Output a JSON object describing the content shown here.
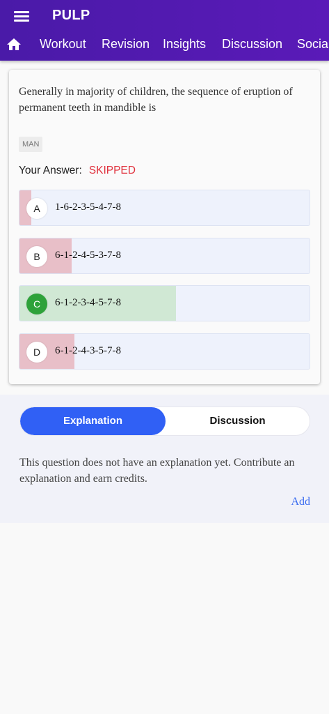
{
  "app": {
    "title": "PULP"
  },
  "tabs": [
    {
      "label": "Workout"
    },
    {
      "label": "Revision"
    },
    {
      "label": "Insights"
    },
    {
      "label": "Discussion"
    },
    {
      "label": "Social"
    }
  ],
  "question": {
    "text": "Generally in majority of children, the sequence of eruption of permanent teeth in mandible is",
    "tag": "MAN",
    "answer_label": "Your Answer:",
    "answer_value": "SKIPPED",
    "options": [
      {
        "letter": "A",
        "text": "1-6-2-3-5-4-7-8",
        "percent": 4,
        "correct": false
      },
      {
        "letter": "B",
        "text": "6-1-2-4-5-3-7-8",
        "percent": 18,
        "correct": false
      },
      {
        "letter": "C",
        "text": "6-1-2-3-4-5-7-8",
        "percent": 54,
        "correct": true
      },
      {
        "letter": "D",
        "text": "6-1-2-4-3-5-7-8",
        "percent": 19,
        "correct": false
      }
    ]
  },
  "colors": {
    "appbar": "#5216b2",
    "correct_fill": "#d0e8d4",
    "wrong_fill": "#e8bfc8",
    "option_bg": "#eef2fc",
    "accent": "#3060f5",
    "skipped": "#e0303c"
  },
  "explanation_section": {
    "tabs": {
      "explanation": "Explanation",
      "discussion": "Discussion"
    },
    "text": "This question does not have an explanation yet. Contribute an explanation and earn credits.",
    "add_label": "Add"
  }
}
